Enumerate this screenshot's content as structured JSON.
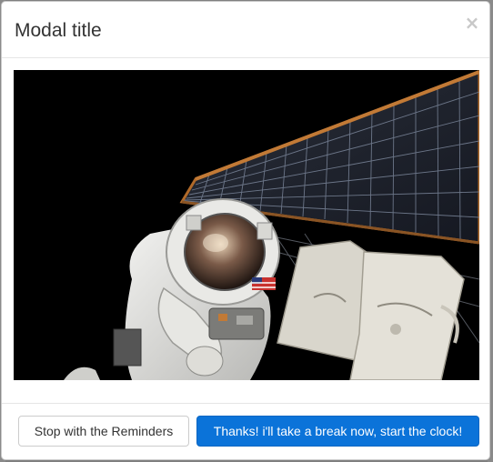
{
  "modal": {
    "title": "Modal title",
    "close_glyph": "×",
    "body": {
      "image_alt": "Astronaut on a spacewalk in front of a solar array"
    },
    "footer": {
      "secondary_label": "Stop with the Reminders",
      "primary_label": "Thanks! i'll take a break now, start the clock!"
    }
  },
  "icons": {
    "close": "close-icon"
  },
  "colors": {
    "primary_button": "#0b73d9",
    "backdrop": "#7f7f7f",
    "modal_background": "#ffffff"
  }
}
